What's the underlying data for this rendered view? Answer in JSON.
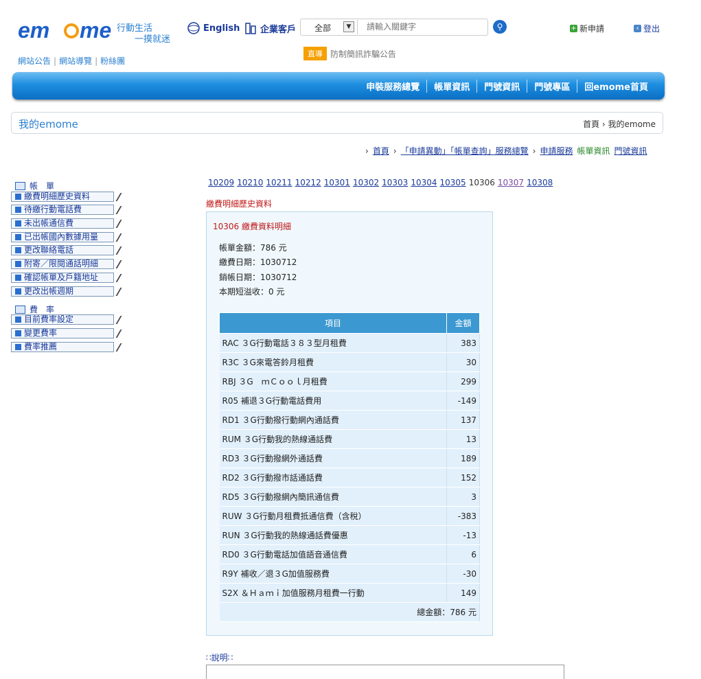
{
  "header": {
    "logo_text": "emome",
    "slogan_line1": "行動生活",
    "slogan_line2": "一摸就迷",
    "links": [
      "網站公告",
      "網站導覽",
      "粉絲團"
    ],
    "english": "English",
    "enterprise": "企業客戶",
    "search": {
      "category": "全部",
      "placeholder": "請輸入關鍵字"
    },
    "new_apply": "新申請",
    "logout": "登出",
    "notice_tag": "直導",
    "notice_text": "防制簡訊詐騙公告"
  },
  "nav": [
    "申裝服務總覽",
    "帳單資訊",
    "門號資訊",
    "門號專區",
    "回emome首頁"
  ],
  "mybar": {
    "title": "我的emome",
    "breadcrumb": "首頁 › 我的emome"
  },
  "sub_breadcrumb": {
    "home": "首頁",
    "services": "「申請異動」「帳單查詢」服務總覽",
    "apply": "申請服務",
    "current": "帳單資訊",
    "number": "門號資訊"
  },
  "sidebar": {
    "group1": "帳　單",
    "group1_items": [
      "繳費明細歷史資料",
      "待繳行動電話費",
      "未出帳通信費",
      "已出帳國內數據用量",
      "更改聯絡電話",
      "附寄／限閱通話明細",
      "確認帳單及戶籍地址",
      "更改出帳週期"
    ],
    "group2": "費　率",
    "group2_items": [
      "目前費率設定",
      "變更費率",
      "費率推薦"
    ]
  },
  "months": [
    "10209",
    "10210",
    "10211",
    "10212",
    "10301",
    "10302",
    "10303",
    "10304",
    "10305",
    "10306",
    "10307",
    "10308"
  ],
  "current_month": "10306",
  "section_title": "繳費明細歷史資料",
  "panel": {
    "title": "10306 繳費資料明細",
    "amount": "帳單金額：786 元",
    "pay_date": "繳費日期：1030712",
    "clear_date": "銷帳日期：1030712",
    "overpay": "本期短溢收：0 元"
  },
  "table": {
    "headers": [
      "項目",
      "金額"
    ],
    "rows": [
      [
        "RAC ３G行動電話３８３型月租費",
        "383"
      ],
      [
        "R3C ３G來電答鈴月租費",
        "30"
      ],
      [
        "RBJ ３G　ｍＣｏｏｌ月租費",
        "299"
      ],
      [
        "R05 補退３G行動電話費用",
        "-149"
      ],
      [
        "RD1 ３G行動撥行動網內通話費",
        "137"
      ],
      [
        "RUM ３G行動我的熱線通話費",
        "13"
      ],
      [
        "RD3 ３G行動撥網外通話費",
        "189"
      ],
      [
        "RD2 ３G行動撥市話通話費",
        "152"
      ],
      [
        "RD5 ３G行動撥網內簡訊通信費",
        "3"
      ],
      [
        "RUW ３G行動月租費抵通信費（含稅）",
        "-383"
      ],
      [
        "RUN ３G行動我的熱線通話費優惠",
        "-13"
      ],
      [
        "RD0 ３G行動電話加值語音通信費",
        "6"
      ],
      [
        "R9Y 補收／退３G加值服務費",
        "-30"
      ],
      [
        "S2X ＆Ｈａｍｉ加值服務月租費一行動",
        "149"
      ]
    ],
    "total": "總金額：786 元"
  },
  "desc_title": "說明"
}
